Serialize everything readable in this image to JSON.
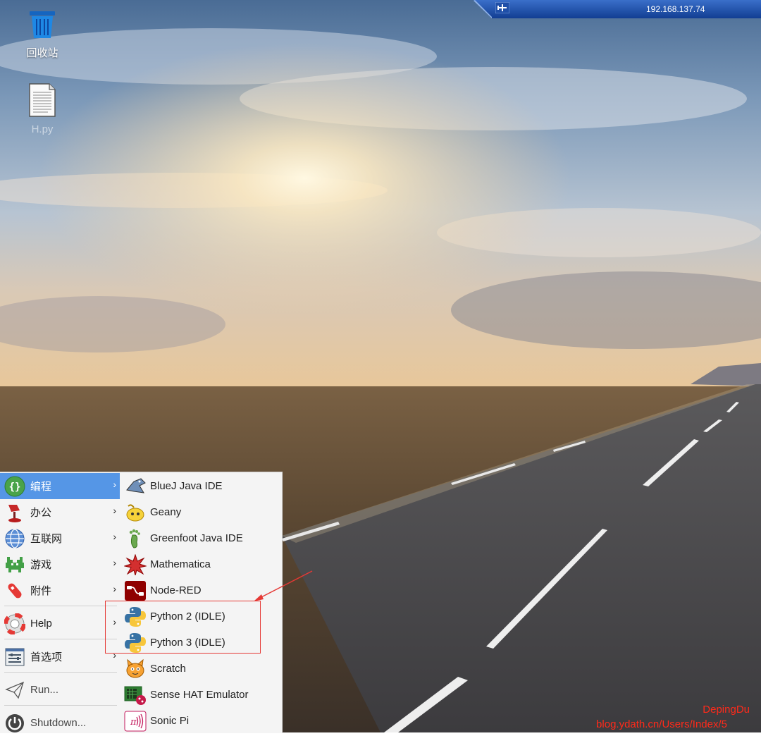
{
  "remote_bar": {
    "ip": "192.168.137.74"
  },
  "desktop": {
    "icons": [
      {
        "label": "回收站",
        "icon": "trash-icon"
      },
      {
        "label": "H.py",
        "icon": "file-icon"
      }
    ]
  },
  "menu": {
    "items": [
      {
        "label": "编程",
        "icon": "programming-icon",
        "has_submenu": true,
        "active": true
      },
      {
        "label": "办公",
        "icon": "office-icon",
        "has_submenu": true
      },
      {
        "label": "互联网",
        "icon": "internet-icon",
        "has_submenu": true
      },
      {
        "label": "游戏",
        "icon": "games-icon",
        "has_submenu": true
      },
      {
        "label": "附件",
        "icon": "accessories-icon",
        "has_submenu": true
      },
      {
        "label": "Help",
        "icon": "help-icon",
        "has_submenu": true
      },
      {
        "label": "首选项",
        "icon": "preferences-icon",
        "has_submenu": true
      },
      {
        "label": "Run...",
        "icon": "run-icon"
      },
      {
        "label": "Shutdown...",
        "icon": "shutdown-icon"
      }
    ],
    "arrow": "›"
  },
  "submenu": {
    "items": [
      {
        "label": "BlueJ Java IDE",
        "icon": "bluej-icon"
      },
      {
        "label": "Geany",
        "icon": "geany-icon"
      },
      {
        "label": "Greenfoot Java IDE",
        "icon": "greenfoot-icon"
      },
      {
        "label": "Mathematica",
        "icon": "mathematica-icon"
      },
      {
        "label": "Node-RED",
        "icon": "node-red-icon"
      },
      {
        "label": "Python 2 (IDLE)",
        "icon": "python-icon"
      },
      {
        "label": "Python 3 (IDLE)",
        "icon": "python-icon"
      },
      {
        "label": "Scratch",
        "icon": "scratch-icon"
      },
      {
        "label": "Sense HAT Emulator",
        "icon": "sense-hat-icon"
      },
      {
        "label": "Sonic Pi",
        "icon": "sonic-pi-icon"
      }
    ]
  },
  "watermark": {
    "line1": "DepingDu",
    "line2": "blog.ydath.cn/Users/Index/5"
  },
  "colors": {
    "menu_highlight": "#5596e6",
    "annotation": "#e53935"
  }
}
